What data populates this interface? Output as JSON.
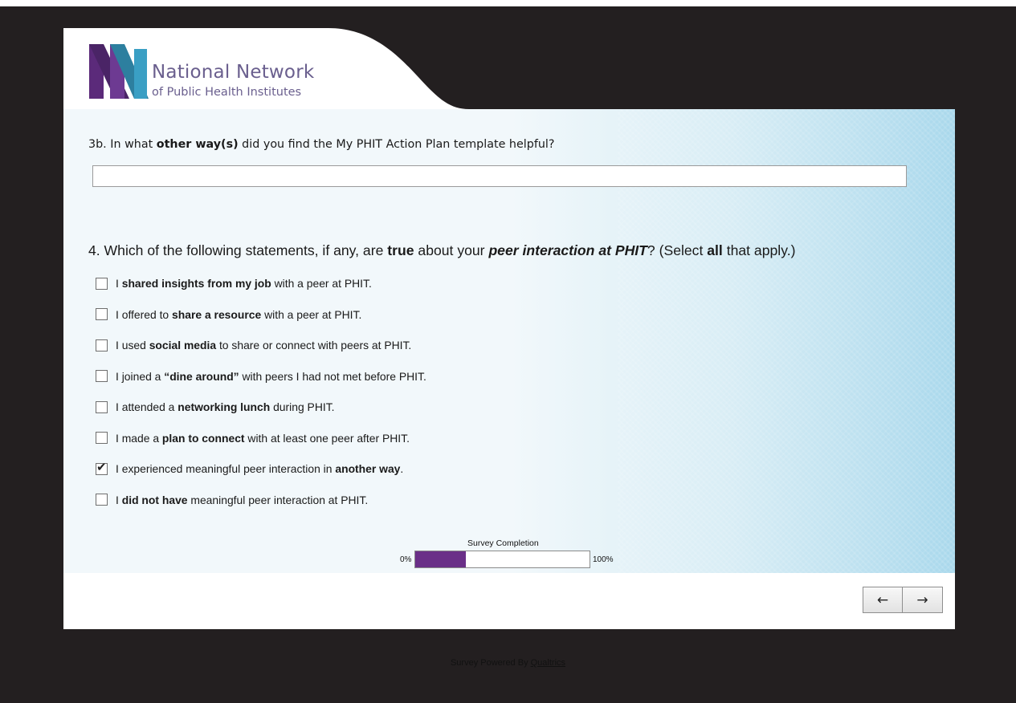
{
  "logo": {
    "line1": "National Network",
    "line2": "of Public Health Institutes"
  },
  "colors": {
    "brand_purple": "#6a2f88",
    "page_background": "#231f20",
    "progress_fill": "#6a2f88"
  },
  "question3b": {
    "number": "3b.",
    "text_before": " In what ",
    "text_bold": "other way(s)",
    "text_after": " did you find the My PHIT Action Plan template helpful?",
    "input_value": ""
  },
  "question4": {
    "t1": "4. Which of the following statements, if any, are ",
    "t2": "true",
    "t3": " about your ",
    "t4": "peer interaction at PHIT",
    "t5": "? (Select ",
    "t6": "all",
    "t7": " that apply.)",
    "options": [
      {
        "before": "I ",
        "bold": "shared insights from my job",
        "after": " with a peer at PHIT.",
        "checked": false
      },
      {
        "before": "I offered to ",
        "bold": "share a resource",
        "after": " with a peer at PHIT.",
        "checked": false
      },
      {
        "before": "I used ",
        "bold": "social media",
        "after": " to share or connect with peers at PHIT.",
        "checked": false
      },
      {
        "before": "I joined a ",
        "bold": "“dine around”",
        "after": " with peers I had not met before PHIT.",
        "checked": false
      },
      {
        "before": "I attended a ",
        "bold": "networking lunch",
        "after": " during PHIT.",
        "checked": false
      },
      {
        "before": "I made a ",
        "bold": "plan to connect",
        "after": " with at least one peer after PHIT.",
        "checked": false
      },
      {
        "before": "I experienced meaningful peer interaction in ",
        "bold": "another way",
        "after": ".",
        "checked": true
      },
      {
        "before": "I ",
        "bold": "did not have",
        "after": " meaningful peer interaction at PHIT.",
        "checked": false
      }
    ]
  },
  "progress": {
    "title": "Survey Completion",
    "min_label": "0%",
    "max_label": "100%",
    "value_percent": 29
  },
  "nav": {
    "back_icon": "←",
    "next_icon": "→"
  },
  "footer": {
    "powered_by": "Survey Powered By ",
    "link_text": "Qualtrics"
  }
}
